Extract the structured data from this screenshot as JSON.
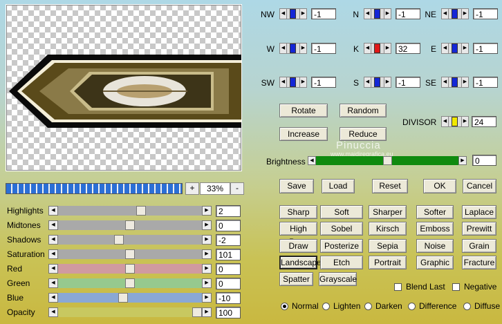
{
  "matrix": {
    "cells": [
      {
        "label": "NW",
        "value": "-1",
        "thumb": "blue"
      },
      {
        "label": "N",
        "value": "-1",
        "thumb": "blue"
      },
      {
        "label": "NE",
        "value": "-1",
        "thumb": "blue"
      },
      {
        "label": "W",
        "value": "-1",
        "thumb": "blue"
      },
      {
        "label": "K",
        "value": "32",
        "thumb": "red"
      },
      {
        "label": "E",
        "value": "-1",
        "thumb": "blue"
      },
      {
        "label": "SW",
        "value": "-1",
        "thumb": "blue"
      },
      {
        "label": "S",
        "value": "-1",
        "thumb": "blue"
      },
      {
        "label": "SE",
        "value": "-1",
        "thumb": "blue"
      }
    ],
    "thumb_colors": {
      "blue": "#1426d6",
      "red": "#e01818",
      "yellow": "#f0e800"
    }
  },
  "actions": {
    "rotate": "Rotate",
    "random": "Random",
    "increase": "Increase",
    "reduce": "Reduce"
  },
  "divisor": {
    "label": "DIVISOR",
    "value": "24"
  },
  "watermark": {
    "name": "Pinuccia",
    "site": "www.maidiregrafica.eu"
  },
  "brightness": {
    "label": "Brightness",
    "value": "0",
    "level": 0.5
  },
  "dialog": {
    "save": "Save",
    "load": "Load",
    "reset": "Reset",
    "ok": "OK",
    "cancel": "Cancel"
  },
  "zoom": {
    "minus": "-",
    "plus": "+",
    "value": "33%",
    "progress": 1.0
  },
  "presets": [
    [
      "Sharp",
      "Soft",
      "Sharper",
      "Softer",
      "Laplace"
    ],
    [
      "High Pass",
      "Sobel",
      "Kirsch",
      "Emboss",
      "Prewitt"
    ],
    [
      "Draw",
      "Posterize",
      "Sepia",
      "Noise",
      "Grain"
    ],
    [
      "Landscape",
      "Etch",
      "Portrait",
      "Graphic",
      "Fracture"
    ],
    [
      "Spatter",
      "Grayscale"
    ]
  ],
  "selected_preset": "Landscape",
  "options": {
    "blend_last": "Blend Last",
    "negative": "Negative",
    "blend_last_checked": false,
    "negative_checked": false
  },
  "blend_modes": {
    "items": [
      "Normal",
      "Lighten",
      "Darken",
      "Difference",
      "Diffuse"
    ],
    "selected": "Normal"
  },
  "adjustments": [
    {
      "label": "Highlights",
      "value": "2",
      "level": 0.58,
      "track": "#a9a9a9"
    },
    {
      "label": "Midtones",
      "value": "0",
      "level": 0.5,
      "track": "#a9a9a9"
    },
    {
      "label": "Shadows",
      "value": "-2",
      "level": 0.42,
      "track": "#a9a9a9"
    },
    {
      "label": "Saturation",
      "value": "101",
      "level": 0.5,
      "track": "#a9a9a9"
    },
    {
      "label": "Red",
      "value": "0",
      "level": 0.5,
      "track": "#d09aa0"
    },
    {
      "label": "Green",
      "value": "0",
      "level": 0.5,
      "track": "#96c98e"
    },
    {
      "label": "Blue",
      "value": "-10",
      "level": 0.45,
      "track": "#8aa8d4"
    },
    {
      "label": "Opacity",
      "value": "100",
      "level": 1.0,
      "track": "#c8c860"
    }
  ]
}
